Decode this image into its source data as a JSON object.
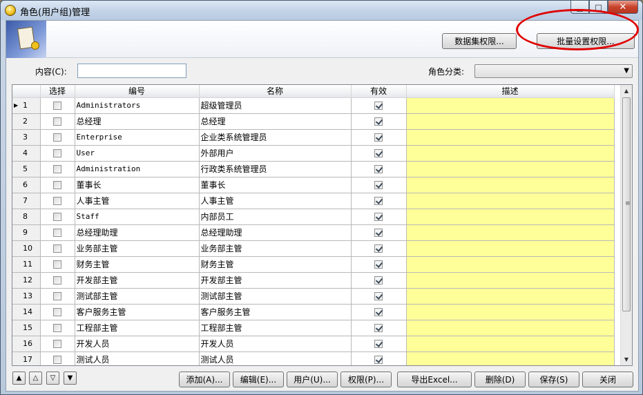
{
  "window": {
    "title": "角色(用户组)管理",
    "min_glyph": "▁",
    "max_glyph": "□",
    "close_glyph": "✕"
  },
  "header": {
    "dataset_perm_label": "数据集权限...",
    "batch_perm_label": "批量设置权限..."
  },
  "filter": {
    "content_label": "内容(C):",
    "content_value": "",
    "category_label": "角色分类:",
    "category_value": ""
  },
  "grid": {
    "columns": [
      "选择",
      "编号",
      "名称",
      "有效",
      "描述"
    ],
    "rows": [
      {
        "n": "1",
        "code": "Administrators",
        "name": "超级管理员",
        "current": true
      },
      {
        "n": "2",
        "code": "总经理",
        "name": "总经理"
      },
      {
        "n": "3",
        "code": "Enterprise",
        "name": "企业类系统管理员"
      },
      {
        "n": "4",
        "code": "User",
        "name": "外部用户"
      },
      {
        "n": "5",
        "code": "Administration",
        "name": "行政类系统管理员"
      },
      {
        "n": "6",
        "code": "董事长",
        "name": "董事长"
      },
      {
        "n": "7",
        "code": "人事主管",
        "name": "人事主管"
      },
      {
        "n": "8",
        "code": "Staff",
        "name": "内部员工"
      },
      {
        "n": "9",
        "code": "总经理助理",
        "name": "总经理助理"
      },
      {
        "n": "10",
        "code": "业务部主管",
        "name": "业务部主管"
      },
      {
        "n": "11",
        "code": "财务主管",
        "name": "财务主管"
      },
      {
        "n": "12",
        "code": "开发部主管",
        "name": "开发部主管"
      },
      {
        "n": "13",
        "code": "测试部主管",
        "name": "测试部主管"
      },
      {
        "n": "14",
        "code": "客户服务主管",
        "name": "客户服务主管"
      },
      {
        "n": "15",
        "code": "工程部主管",
        "name": "工程部主管"
      },
      {
        "n": "16",
        "code": "开发人员",
        "name": "开发人员"
      },
      {
        "n": "17",
        "code": "测试人员",
        "name": "测试人员"
      }
    ]
  },
  "nav": {
    "first": "▲",
    "prev": "△",
    "next": "▽",
    "last": "▼"
  },
  "actions": {
    "add": "添加(A)...",
    "edit": "编辑(E)...",
    "users": "用户(U)...",
    "perm": "权限(P)...",
    "export": "导出Excel...",
    "delete": "删除(D)",
    "save": "保存(S)",
    "close": "关闭"
  },
  "colors": {
    "description_fill": "#ffff99",
    "highlight_ring": "#e00000"
  }
}
